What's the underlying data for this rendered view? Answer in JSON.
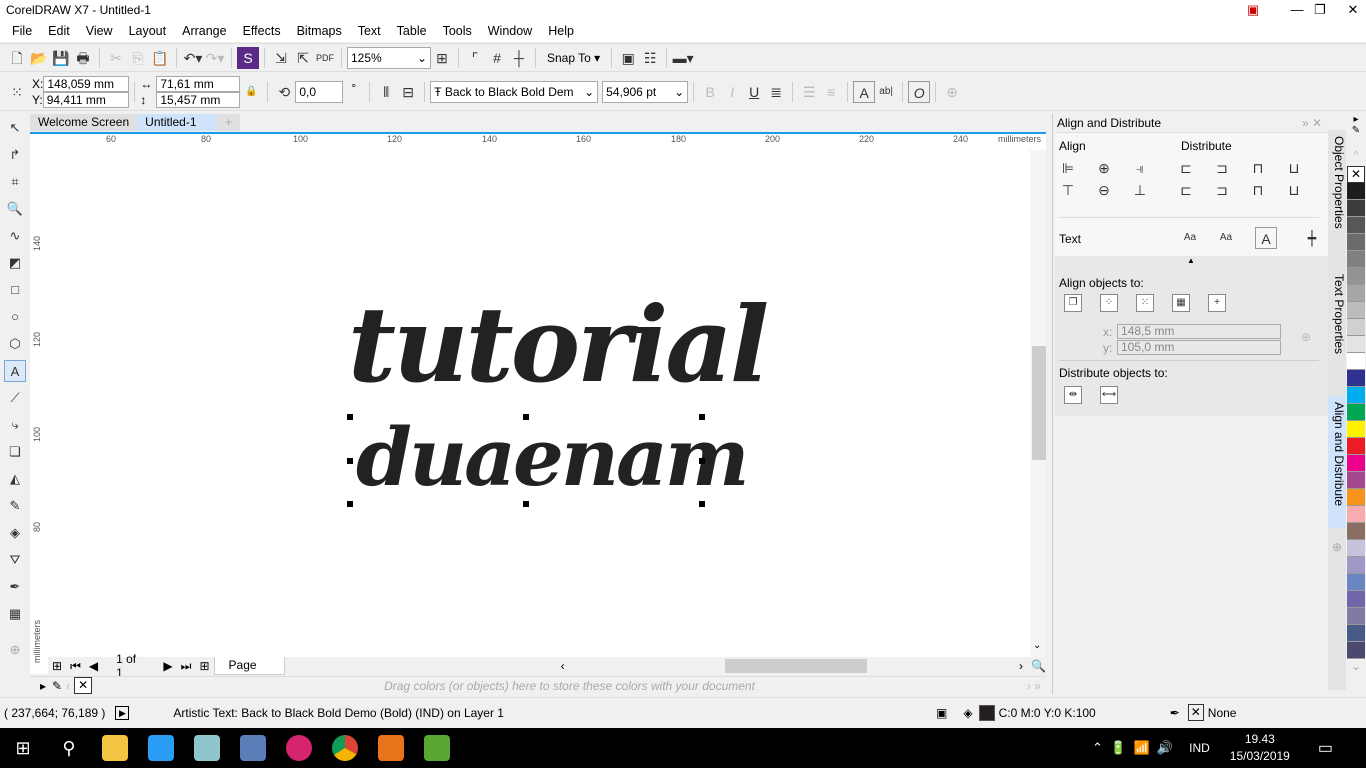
{
  "window": {
    "title": "CorelDRAW X7 - Untitled-1"
  },
  "menu": [
    "File",
    "Edit",
    "View",
    "Layout",
    "Arrange",
    "Effects",
    "Bitmaps",
    "Text",
    "Table",
    "Tools",
    "Window",
    "Help"
  ],
  "toolbar": {
    "zoom": "125%",
    "snap_to": "Snap To"
  },
  "propbar": {
    "x_label": "X:",
    "x": "148,059 mm",
    "y_label": "Y:",
    "y": "94,411 mm",
    "width": "71,61 mm",
    "height": "15,457 mm",
    "rotation": "0,0",
    "degree": "°",
    "font": "Back to Black Bold Dem",
    "font_size": "54,906 pt"
  },
  "tabs": [
    {
      "label": "Welcome Screen"
    },
    {
      "label": "Untitled-1",
      "active": true
    }
  ],
  "ruler": {
    "h_ticks": [
      "60",
      "80",
      "100",
      "120",
      "140",
      "160",
      "180",
      "200",
      "220",
      "240"
    ],
    "h_unit": "millimeters",
    "v_ticks": [
      "140",
      "120",
      "100",
      "80"
    ],
    "v_unit": "millimeters"
  },
  "canvas": {
    "line1": "tutorial",
    "line2": "duaenam"
  },
  "pagenav": {
    "count": "1 of 1",
    "page": "Page 1"
  },
  "docpal": {
    "hint": "Drag colors (or objects) here to store these colors with your document"
  },
  "docker": {
    "title": "Align and Distribute",
    "align": "Align",
    "distribute": "Distribute",
    "text": "Text",
    "align_to": "Align objects to:",
    "x_label": "x:",
    "x": "148,5 mm",
    "y_label": "y:",
    "y": "105,0 mm",
    "distribute_to": "Distribute objects to:"
  },
  "vtabs": [
    "Object Properties",
    "Text Properties",
    "Align and Distribute"
  ],
  "palette": [
    "#1d1d1d",
    "#3c3c3c",
    "#575757",
    "#6b6b6b",
    "#808080",
    "#939393",
    "#a6a6a6",
    "#bcbcbc",
    "#d0d0d0",
    "#e3e3e3",
    "#ffffff",
    "#2e3192",
    "#00aeef",
    "#00a651",
    "#fff200",
    "#ed1c24",
    "#ec008c",
    "#a3478e",
    "#f7941d",
    "#f9acb0",
    "#8b6e63",
    "#c8c3dd",
    "#9f98c8",
    "#6a86c2",
    "#6f66ab",
    "#807ba0",
    "#475a88",
    "#4b4a6e"
  ],
  "status": {
    "coords": "( 237,664; 76,189 )",
    "info": "Artistic Text: Back to Black Bold Demo (Bold) (IND) on Layer 1",
    "fill": "C:0 M:0 Y:0 K:100",
    "fill_color": "#231f20",
    "outline": "None"
  },
  "taskbar": {
    "lang": "IND",
    "time": "19.43",
    "date": "15/03/2019"
  }
}
